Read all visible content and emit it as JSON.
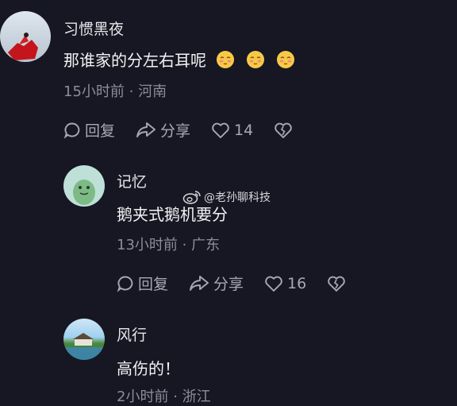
{
  "comments": [
    {
      "username": "习惯黑夜",
      "text": "那谁家的分左右耳呢",
      "emojis": [
        "shy-blush-emoji",
        "shy-blush-emoji",
        "shy-blush-emoji"
      ],
      "time": "15小时前",
      "location": "河南",
      "reply_label": "回复",
      "share_label": "分享",
      "likes": "14"
    },
    {
      "username": "记忆",
      "text": "鹅夹式鹅机要分",
      "time": "13小时前",
      "location": "广东",
      "reply_label": "回复",
      "share_label": "分享",
      "likes": "16"
    },
    {
      "username": "风行",
      "text": "高伤的！",
      "time": "2小时前",
      "location": "浙江"
    }
  ],
  "watermark": {
    "text": "@老孙聊科技",
    "icon": "weibo-icon"
  },
  "colors": {
    "background": "#161722",
    "meta": "#8c8d98",
    "icon": "#a7a8b2"
  }
}
